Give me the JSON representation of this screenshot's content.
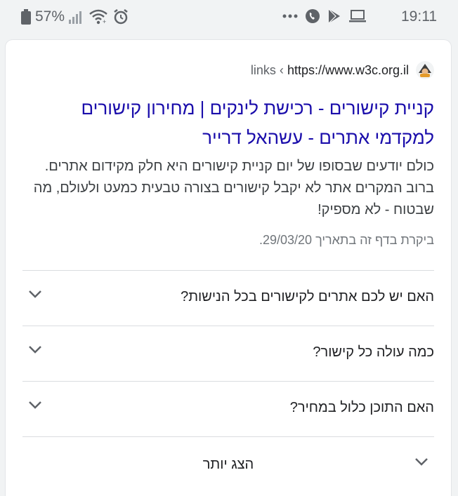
{
  "status_bar": {
    "battery_percent": "57%",
    "time": "19:11",
    "icons": [
      "battery-icon",
      "signal-icon",
      "wifi-icon",
      "alarm-icon",
      "more-dots-icon",
      "phone-icon",
      "play-store-icon",
      "laptop-icon"
    ]
  },
  "result": {
    "favicon": "site-favicon",
    "breadcrumb_url": "https://www.w3c.org.il",
    "breadcrumb_path": "links ‹ ",
    "title": "קניית קישורים - רכישת לינקים | מחירון קישורים למקדמי אתרים - עשהאל דרייר",
    "snippet": "כולם יודעים שבסופו של יום קניית קישורים היא חלק מקידום אתרים. ברוב המקרים אתר לא יקבל קישורים בצורה טבעית כמעט ולעולם, מה שבטוח - לא מספיק!",
    "visited": "ביקרת בדף זה בתאריך 29/03/20."
  },
  "faq": [
    {
      "question": "האם יש לכם אתרים לקישורים בכל הנישות?"
    },
    {
      "question": "כמה עולה כל קישור?"
    },
    {
      "question": "האם התוכן כלול במחיר?"
    }
  ],
  "show_more": {
    "label": "הצג יותר"
  },
  "colors": {
    "link": "#1a0dab",
    "text": "#202124",
    "muted": "#70757a",
    "divider": "#dadce0"
  }
}
